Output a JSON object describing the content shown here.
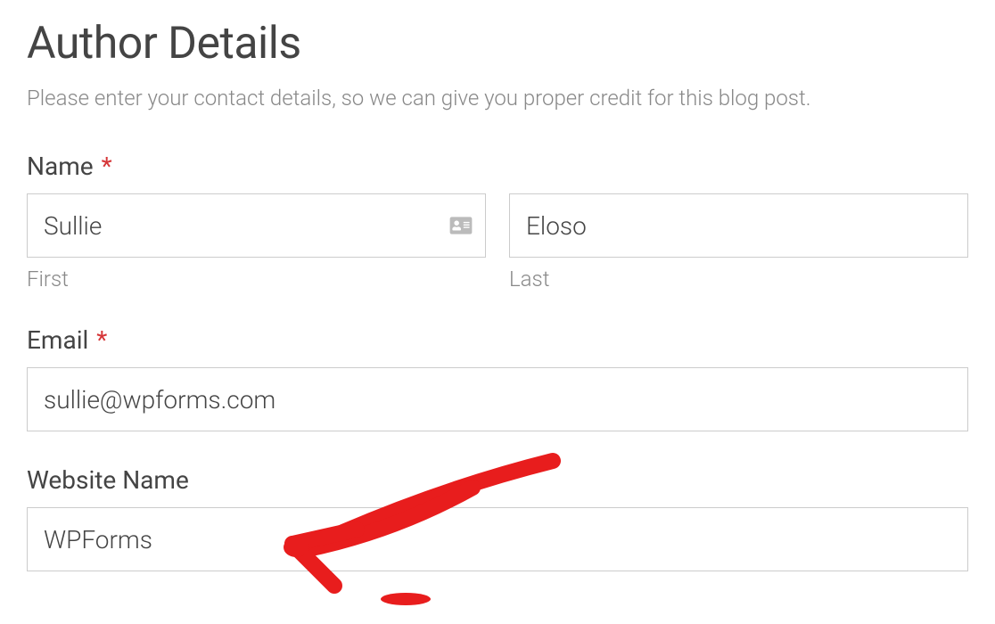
{
  "heading": "Author Details",
  "description": "Please enter your contact details, so we can give you proper credit for this blog post.",
  "required_mark": "*",
  "name": {
    "label": "Name",
    "first_sublabel": "First",
    "last_sublabel": "Last",
    "first_value": "Sullie",
    "last_value": "Eloso"
  },
  "email": {
    "label": "Email",
    "value": "sullie@wpforms.com"
  },
  "website": {
    "label": "Website Name",
    "value": "WPForms"
  }
}
